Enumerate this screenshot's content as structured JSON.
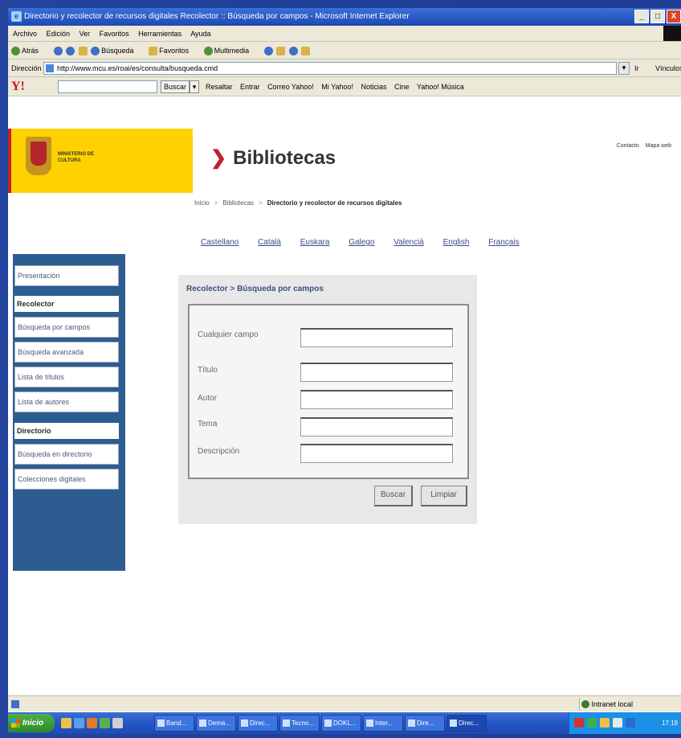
{
  "window": {
    "title": "Directorio y recolector de recursos digitales Recolector :: Búsqueda por campos - Microsoft Internet Explorer",
    "controls": [
      "_",
      "□",
      "X"
    ]
  },
  "menubar": {
    "items": [
      "Archivo",
      "Edición",
      "Ver",
      "Favoritos",
      "Herramientas",
      "Ayuda"
    ]
  },
  "toolbar": {
    "items": [
      "Atrás",
      "Búsqueda",
      "Favoritos",
      "Multimedia"
    ]
  },
  "addressbar": {
    "label": "Dirección",
    "url": "http://www.mcu.es/roai/es/consulta/busqueda.cmd",
    "go_label": "Ir",
    "links_label": "Vínculos"
  },
  "yahoobar": {
    "logo": "Y!",
    "search_button": "Buscar",
    "items": [
      "Resaltar",
      "Entrar",
      "Correo Yahoo!",
      "Mi Yahoo!",
      "Noticias",
      "Cine",
      "Yahoo! Música"
    ]
  },
  "header": {
    "ministry": "MINISTERIO DE CULTURA",
    "site_title": "Bibliotecas",
    "top_links": [
      "Contacto",
      "Mapa web"
    ]
  },
  "breadcrumb": [
    "Inicio",
    "Bibliotecas",
    "Directorio y recolector de recursos digitales"
  ],
  "languages": [
    "Castellano",
    "Català",
    "Euskara",
    "Galego",
    "Valencià",
    "English",
    "Français"
  ],
  "sidebar": {
    "presentacion": "Presentación",
    "recolector_head": "Recolector",
    "recolector_items": [
      "Búsqueda por campos",
      "Búsqueda avanzada",
      "Lista de títulos",
      "Lista de autores"
    ],
    "directorio_head": "Directorio",
    "directorio_items": [
      "Búsqueda en directorio",
      "Colecciones digitales"
    ]
  },
  "search_panel": {
    "title": "Recolector > Búsqueda por campos",
    "fields": [
      {
        "label": "Cualquier campo",
        "value": ""
      },
      {
        "label": "Título",
        "value": ""
      },
      {
        "label": "Autor",
        "value": ""
      },
      {
        "label": "Tema",
        "value": ""
      },
      {
        "label": "Descripción",
        "value": ""
      }
    ],
    "search_button": "Buscar",
    "clear_button": "Limpiar"
  },
  "statusbar": {
    "zone": "Intranet local"
  },
  "taskbar": {
    "start": "Inicio",
    "tasks": [
      "Band...",
      "Dema...",
      "Direc...",
      "Tecno...",
      "DOKL...",
      "Inter...",
      "Dire...",
      "Direc..."
    ],
    "clock": "17:19"
  }
}
